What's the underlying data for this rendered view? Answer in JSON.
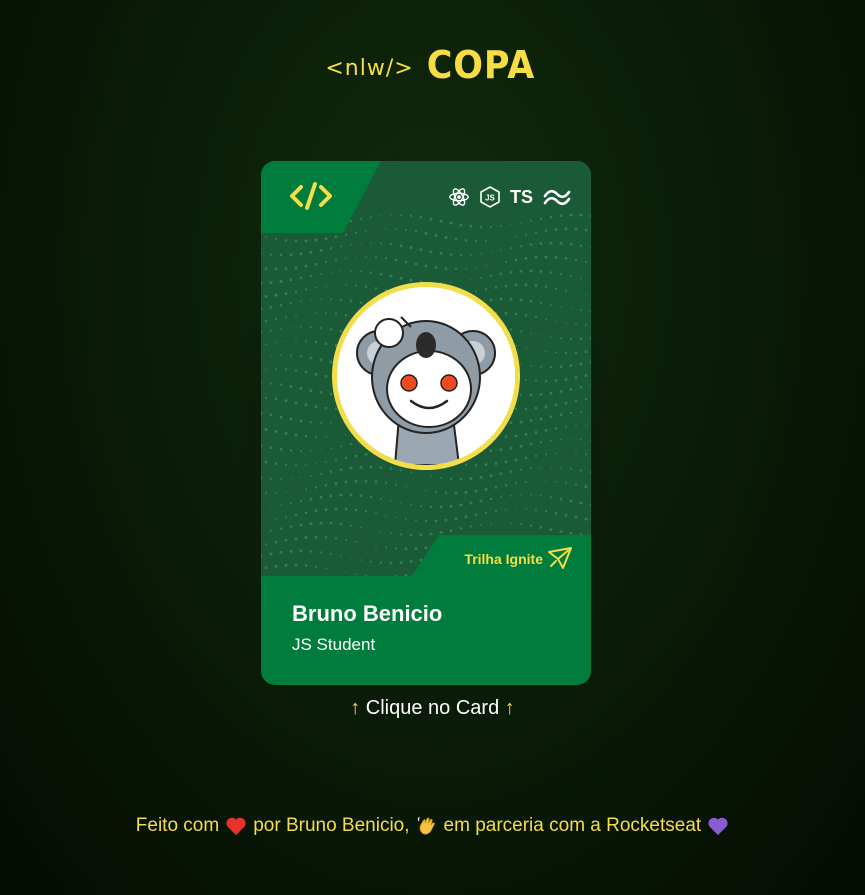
{
  "logo": {
    "prefix": "<nlw/>",
    "title": "COPA"
  },
  "card": {
    "tech_icons": [
      "react-icon",
      "nodejs-icon",
      "typescript-icon",
      "tailwind-icon"
    ],
    "ts_label": "TS",
    "trilha_label": "Trilha Ignite",
    "user_name": "Bruno Benicio",
    "user_role": "JS Student"
  },
  "hint": {
    "arrow_left": "↑",
    "text": " Clique no Card ",
    "arrow_right": "↑"
  },
  "footer": {
    "part1": "Feito com",
    "part2": "por Bruno Benicio,",
    "part3": "em parceria com a Rocketseat"
  },
  "colors": {
    "accent_yellow": "#f4dd4a",
    "card_green": "#007d3c",
    "card_dark": "#1a5a36"
  }
}
